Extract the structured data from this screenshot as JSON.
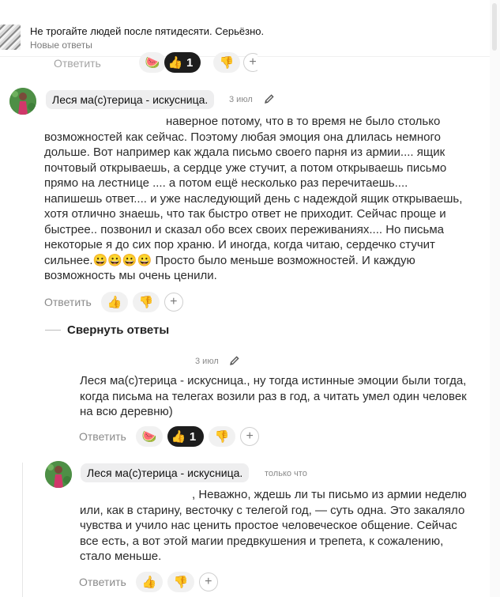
{
  "notification": {
    "title": "Не трогайте людей после пятидесяти. Серьёзно.",
    "subtitle": "Новые ответы"
  },
  "hidden_row": {
    "reply_label": "Ответить",
    "dark_count": "1"
  },
  "comment1": {
    "author": "Леся ма(с)терица - искусница.",
    "date": "3 июл",
    "lines": [
      "наверное потому, что в то время не было столько",
      "возможностей как сейчас. Поэтому любая эмоция она длилась немного",
      "дольше. Вот например как ждала письмо своего парня из армии.... ящик",
      "почтовый открываешь, а сердце уже стучит, а потом открываешь письмо",
      "прямо на лестнице .... а потом ещё несколько раз перечитаешь....",
      "напишешь ответ.... и уже наследующий день с надеждой ящик открываешь,",
      "хотя отлично знаешь, что так быстро ответ не приходит. Сейчас проще и",
      "быстрее.. позвонил и сказал обо всех своих переживаниях.... Но письма",
      "некоторые я до сих пор храню. И иногда, когда читаю, сердечко стучит",
      "сильнее.😀😀😀😀 Просто было меньше возможностей. И каждую",
      "возможность мы очень ценили."
    ],
    "reply_label": "Ответить"
  },
  "collapse_label": "Свернуть ответы",
  "comment2": {
    "date": "3 июл",
    "lines": [
      "Леся ма(с)терица - искусница., ну тогда истинные эмоции были тогда,",
      "когда письма на телегах возили раз в год, а читать умел один человек",
      "на всю деревню)"
    ],
    "reply_label": "Ответить",
    "dark_count": "1"
  },
  "comment3": {
    "author": "Леся ма(с)терица - искусница.",
    "date": "только что",
    "lines": [
      ", Неважно, ждешь ли ты письмо из армии неделю",
      "или, как в старину, весточку с телегой год, — суть одна. Это закаляло",
      "чувства и учило нас ценить простое человеческое общение. Сейчас",
      "все есть, а вот этой магии предвкушения и трепета, к сожалению,",
      "стало меньше."
    ],
    "reply_label": "Ответить"
  },
  "reactions": {
    "like": "👍",
    "dislike": "👎",
    "watermelon": "🍉",
    "plus": "+"
  },
  "colors": {
    "pill_bg": "#eeeeef",
    "dark_reaction": "#1d1d1d",
    "muted_text": "#8a8a8a"
  }
}
